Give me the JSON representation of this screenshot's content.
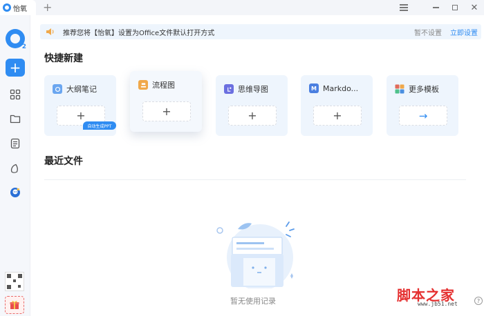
{
  "titlebar": {
    "tab_title": "怡氧",
    "new_tab": "+",
    "close_glyph": "✕"
  },
  "notice": {
    "text": "推荐您将【怡氧】设置为Office文件默认打开方式",
    "later": "暂不设置",
    "set_now": "立即设置"
  },
  "quick": {
    "title": "快捷新建",
    "cards": [
      {
        "label": "大纲笔记",
        "icon": "outline-note-icon",
        "color": "#6aa6f0",
        "button": "+",
        "badge": "自动生成PPT"
      },
      {
        "label": "流程图",
        "icon": "flowchart-icon",
        "color": "#f0a84a",
        "button": "+"
      },
      {
        "label": "思维导图",
        "icon": "mindmap-icon",
        "color": "#6b6fe0",
        "button": "+"
      },
      {
        "label": "Markdo...",
        "icon": "markdown-icon",
        "icon_text": "M",
        "color": "#4a7fe0",
        "button": "+"
      },
      {
        "label": "更多模板",
        "icon": "templates-icon",
        "color": "#e06b5a",
        "button": "→"
      }
    ]
  },
  "recent": {
    "title": "最近文件",
    "empty_text": "暂无使用记录"
  },
  "watermark": {
    "main": "脚本之家",
    "sub": "www.jb51.net"
  },
  "help_glyph": "?",
  "colors": {
    "accent": "#2f8cf2",
    "notice_bg": "#eef5fd",
    "card_bg": "#eef5fd"
  }
}
